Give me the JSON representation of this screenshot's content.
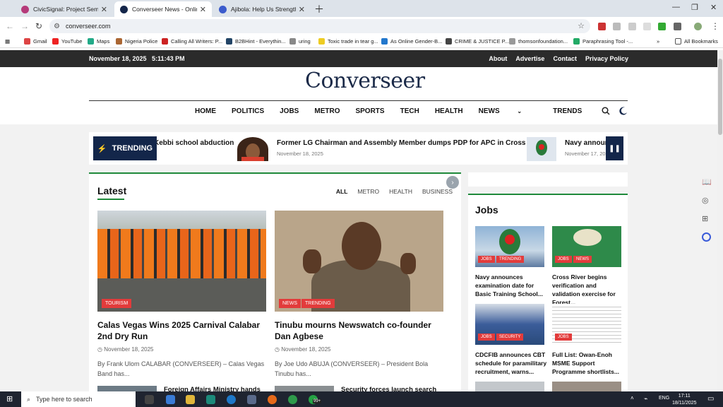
{
  "browser": {
    "tabs": [
      {
        "title": "CivicSignal: Project Sembra: Pro",
        "active": false,
        "color": "#b53a7a"
      },
      {
        "title": "Converseer News - Online News",
        "active": true,
        "color": "#14264a"
      },
      {
        "title": "Ajibola: Help Us Strengthen Afr",
        "active": false,
        "color": "#3b5bcc"
      }
    ],
    "url": "converseer.com",
    "bookmarks": [
      {
        "label": "Gmail",
        "color": "#d44"
      },
      {
        "label": "YouTube",
        "color": "#e22"
      },
      {
        "label": "Maps",
        "color": "#2a8"
      },
      {
        "label": "Nigeria Police",
        "color": "#a63"
      },
      {
        "label": "Calling All Writers: P...",
        "color": "#c22"
      },
      {
        "label": "B2BHint - Everythin...",
        "color": "#246"
      },
      {
        "label": "uring",
        "color": "#888"
      },
      {
        "label": "Toxic trade in tear g...",
        "color": "#ec2"
      },
      {
        "label": "As Online Gender-B...",
        "color": "#27c"
      },
      {
        "label": "CRIME & JUSTICE P...",
        "color": "#444"
      },
      {
        "label": "thomsonfoundation...",
        "color": "#999"
      },
      {
        "label": "Paraphrasing Tool -...",
        "color": "#2a6"
      }
    ],
    "all_bookmarks": "All Bookmarks"
  },
  "site": {
    "datetime": "November 18, 2025   5:11:43 PM",
    "top_links": [
      "About",
      "Advertise",
      "Contact",
      "Privacy Policy"
    ],
    "logo": "Converseer",
    "nav": [
      "HOME",
      "POLITICS",
      "JOBS",
      "METRO",
      "SPORTS",
      "TECH",
      "HEALTH",
      "NEWS",
      "TRENDS"
    ],
    "trending": {
      "label": "TRENDING",
      "items": [
        {
          "title": "Kebbi school abduction",
          "date": ""
        },
        {
          "title": "Former LG Chairman and Assembly Member dumps PDP for APC in Cross River",
          "date": "November 18, 2025"
        },
        {
          "title": "Navy announc",
          "date": "November 17, 202"
        }
      ]
    },
    "latest": {
      "title": "Latest",
      "filters": [
        "ALL",
        "METRO",
        "HEALTH",
        "BUSINESS"
      ],
      "cards": [
        {
          "badges": [
            "TOURISM"
          ],
          "title": "Calas Vegas Wins 2025 Carnival Calabar 2nd Dry Run",
          "date": "November 18, 2025",
          "excerpt": "By Frank Ulom CALABAR (CONVERSEER) – Calas Vegas Band has..."
        },
        {
          "badges": [
            "NEWS",
            "TRENDING"
          ],
          "title": "Tinubu mourns Newswatch co-founder Dan Agbese",
          "date": "November 18, 2025",
          "excerpt": "By Joe Udo ABUJA (CONVERSEER) – President Bola Tinubu has..."
        }
      ],
      "peek": [
        "Foreign Affairs Ministry hands",
        "Security forces launch search"
      ]
    },
    "jobs": {
      "title": "Jobs",
      "items": [
        {
          "badges": [
            "JOBS",
            "TRENDING"
          ],
          "title": "Navy announces examination date for Basic Training School..."
        },
        {
          "badges": [
            "JOBS",
            "NEWS"
          ],
          "title": "Cross River begins verification and validation exercise for Forest..."
        },
        {
          "badges": [
            "JOBS",
            "SECURITY"
          ],
          "title": "CDCFIB announces CBT schedule for paramilitary recruitment, warns..."
        },
        {
          "badges": [
            "JOBS"
          ],
          "title": "Full List: Owan-Enoh MSME Support Programme shortlists..."
        }
      ]
    }
  },
  "taskbar": {
    "search_placeholder": "Type here to search",
    "lang": "ENG",
    "time": "17:11",
    "date": "18/11/2025",
    "badge": "99+"
  },
  "colors": {
    "navy": "#13264a",
    "green": "#1f8a3b",
    "badge": "#e23b3b"
  }
}
